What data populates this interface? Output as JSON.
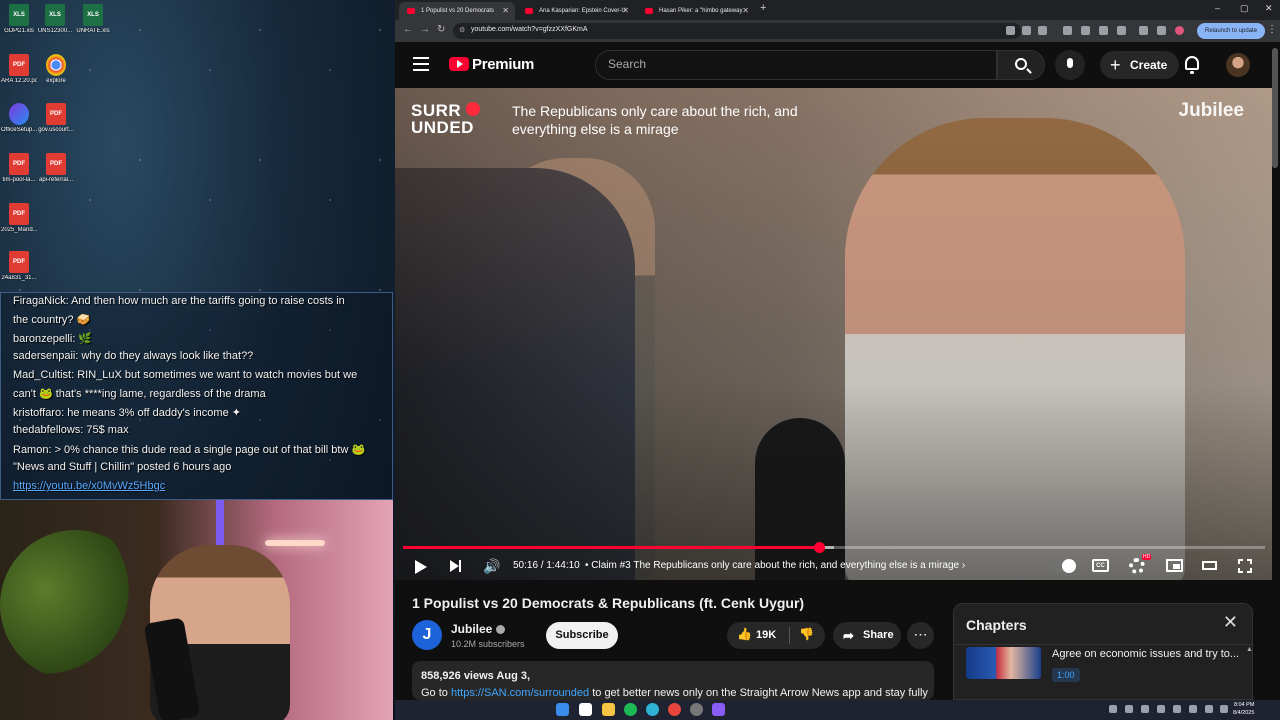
{
  "desktop": {
    "icons": [
      {
        "label": "GDPC1.xls",
        "type": "xls"
      },
      {
        "label": "UNS12300...",
        "type": "xls"
      },
      {
        "label": "UNRATE.xls",
        "type": "xls"
      },
      {
        "label": "ARA 12.20.pdf",
        "type": "pdf"
      },
      {
        "label": "explore",
        "type": "chrome"
      },
      {
        "label": "OfficeSetup...",
        "type": "office"
      },
      {
        "label": "gov.uscourt...",
        "type": "pdf"
      },
      {
        "label": "tim-pool-la...",
        "type": "pdf"
      },
      {
        "label": "api-referral...",
        "type": "pdf"
      },
      {
        "label": "2025_Mand...",
        "type": "pdf"
      },
      {
        "label": "24a831_31...",
        "type": "pdf"
      }
    ],
    "chat": [
      {
        "text": "FiragaNick: And then how much are the tariffs going to raise costs in"
      },
      {
        "text": "the country? 🥪"
      },
      {
        "text": "baronzepelli: 🌿"
      },
      {
        "text": "sadersenpaii: why do they always look like that??"
      },
      {
        "text": "Mad_Cultist: RIN_LuX but sometimes we want to watch movies but we"
      },
      {
        "text": "can't 🐸 that's ****ing lame, regardless of the drama"
      },
      {
        "text": "kristoffaro: he means 3% off daddy's income ✦"
      },
      {
        "text": "thedabfellows: 75$ max"
      },
      {
        "text": "Ramon: > 0% chance this dude read a single page out of that bill btw 🐸"
      },
      {
        "text": "\"News and Stuff | Chillin\" posted 6 hours ago"
      },
      {
        "text": "https://youtu.be/x0MvWz5Hbgc",
        "link": true
      }
    ]
  },
  "browser": {
    "tabs": [
      {
        "title": "1 Populist vs 20 Democrats",
        "active": true
      },
      {
        "title": "Ana Kasparian: Epstein Cover-U",
        "active": false
      },
      {
        "title": "Hasan Piker: a \"himbo gateway",
        "active": false
      }
    ],
    "new_tab": "+",
    "window_controls": [
      "–",
      "▢",
      "✕"
    ],
    "url": "youtube.com/watch?v=gfzzXXfGKmA",
    "relaunch_label": "Relaunch to update",
    "colors": {
      "accent": "#ff0033",
      "bg": "#0f0f0f",
      "link": "#3ea6ff"
    }
  },
  "youtube": {
    "brand": "Premium",
    "search_placeholder": "Search",
    "create_label": "Create",
    "video": {
      "overlay_brand_line1": "SURR",
      "overlay_brand_line2": "UNDED",
      "overlay_caption": "The Republicans only care about the rich, and everything else is a mirage",
      "overlay_jubilee": "Jubilee",
      "current_time": "50:16",
      "duration": "1:44:10",
      "progress": 0.4826,
      "buffered": 0.5,
      "chapter": "• Claim #3 The Republicans only care about the rich, and everything else is a mirage",
      "chapter_arrow": "›",
      "cc_label": "CC",
      "hd_badge": "HD"
    },
    "title": "1 Populist vs 20 Democrats & Republicans (ft. Cenk Uygur)",
    "channel": {
      "avatar_letter": "J",
      "name": "Jubilee",
      "subscribers": "10.2M subscribers",
      "subscribe_label": "Subscribe"
    },
    "likes": "19K",
    "share_label": "Share",
    "more_label": "⋯",
    "description": {
      "stats": "858,926 views  Aug 3,",
      "line_prefix": "Go to ",
      "link": "https://SAN.com/surrounded",
      "line_suffix": " to get better news only on the Straight Arrow News app and stay fully"
    },
    "chapters": {
      "heading": "Chapters",
      "items": [
        {
          "title": "Agree on economic issues and try to...",
          "time": "1:00"
        }
      ]
    }
  },
  "taskbar": {
    "time": "8:04 PM",
    "date": "8/4/2025"
  }
}
